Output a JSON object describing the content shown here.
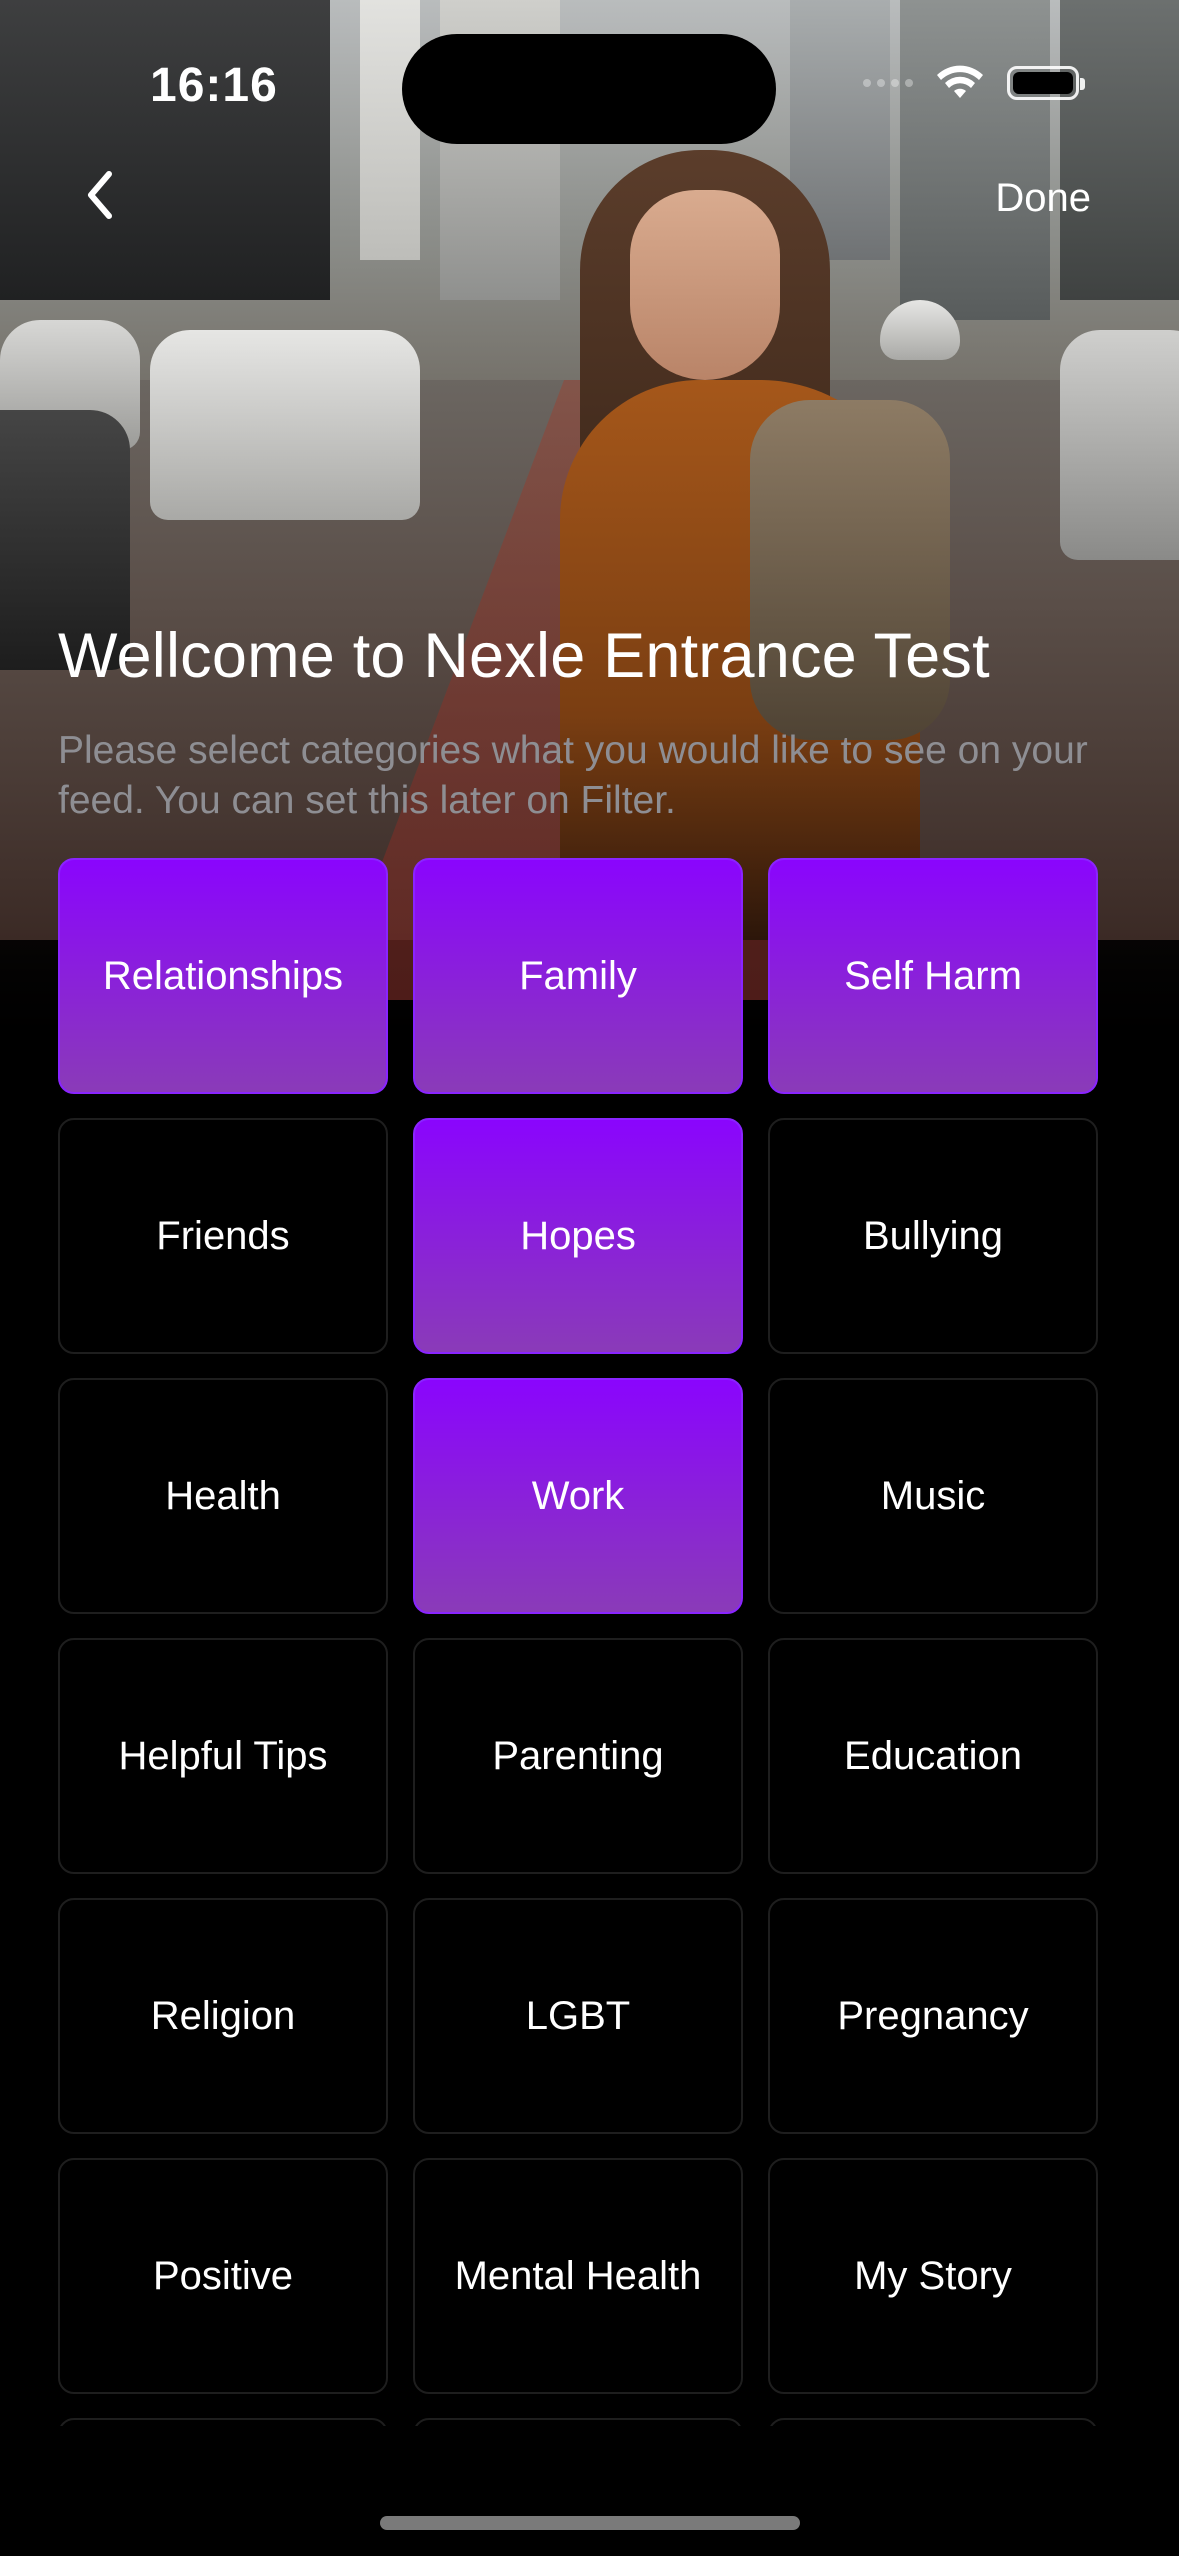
{
  "status_bar": {
    "time": "16:16"
  },
  "nav": {
    "back_icon": "chevron-left-icon",
    "done_label": "Done"
  },
  "header": {
    "title": "Wellcome to Nexle Entrance Test",
    "subtitle": "Please select categories what you would like to see on your feed. You can set this later on Filter."
  },
  "categories": [
    {
      "label": "Relationships",
      "selected": true
    },
    {
      "label": "Family",
      "selected": true
    },
    {
      "label": "Self Harm",
      "selected": true
    },
    {
      "label": "Friends",
      "selected": false
    },
    {
      "label": "Hopes",
      "selected": true
    },
    {
      "label": "Bullying",
      "selected": false
    },
    {
      "label": "Health",
      "selected": false
    },
    {
      "label": "Work",
      "selected": true
    },
    {
      "label": "Music",
      "selected": false
    },
    {
      "label": "Helpful Tips",
      "selected": false
    },
    {
      "label": "Parenting",
      "selected": false
    },
    {
      "label": "Education",
      "selected": false
    },
    {
      "label": "Religion",
      "selected": false
    },
    {
      "label": "LGBT",
      "selected": false
    },
    {
      "label": "Pregnancy",
      "selected": false
    },
    {
      "label": "Positive",
      "selected": false
    },
    {
      "label": "Mental Health",
      "selected": false
    },
    {
      "label": "My Story",
      "selected": false
    },
    {
      "label": "",
      "selected": false
    },
    {
      "label": "",
      "selected": false
    },
    {
      "label": "",
      "selected": false
    }
  ],
  "colors": {
    "selected_gradient_top": "#8a05fd",
    "selected_gradient_bottom": "#8a3bb8",
    "unselected_border": "#1e1e1e",
    "subtitle_gray": "#8e8e93",
    "background": "#000000"
  }
}
